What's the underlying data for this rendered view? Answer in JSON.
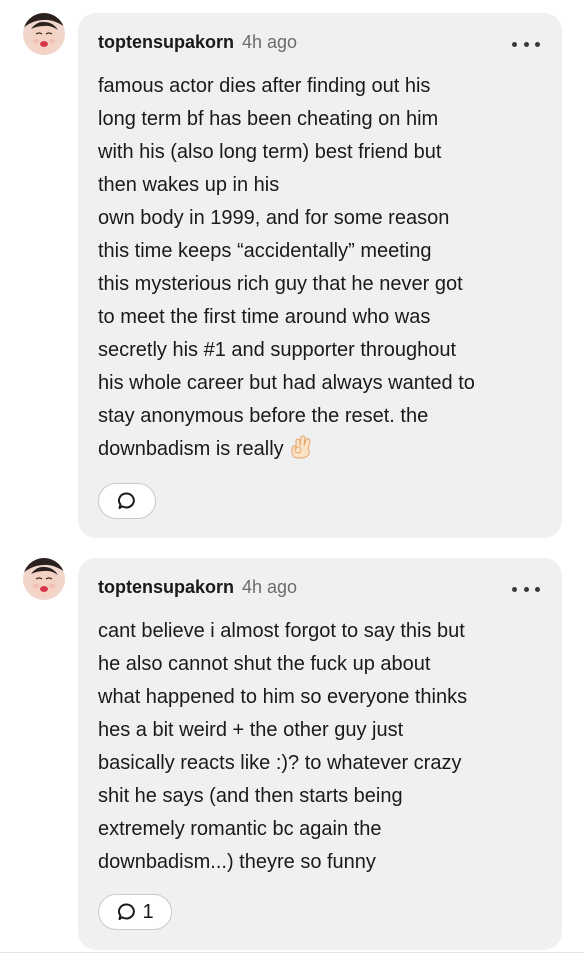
{
  "comments": [
    {
      "username": "toptensupakorn",
      "time": "4h ago",
      "lines": [
        "famous actor dies after finding out his",
        "long term bf has been cheating on him",
        "with his (also long term) best friend but",
        "then wakes up in his",
        "own body in 1999, and for some reason",
        "this time keeps “accidentally” meeting",
        "this mysterious rich guy that he never got",
        "to meet the first time around who was",
        "secretly his #1 and supporter throughout",
        "his whole career but had always wanted to",
        "stay anonymous before the reset. the",
        "downbadism is really"
      ],
      "emoji": "ok-hand-emoji",
      "reply_count": ""
    },
    {
      "username": "toptensupakorn",
      "time": "4h ago",
      "lines": [
        "cant believe i almost forgot to say this but",
        "he also cannot shut the fuck up about",
        "what happened to him so everyone thinks",
        "hes a bit weird + the other guy just",
        "basically reacts like :)? to whatever crazy",
        "shit he says (and then starts being",
        "extremely romantic bc again the",
        "downbadism...) theyre so funny"
      ],
      "reply_count": "1"
    }
  ],
  "icons": {
    "more": "more-dots-icon",
    "reply": "speech-bubble-icon"
  },
  "colors": {
    "bubble_bg": "#eef0f2",
    "text": "#1a1a1a",
    "muted": "#6b6b6b"
  }
}
